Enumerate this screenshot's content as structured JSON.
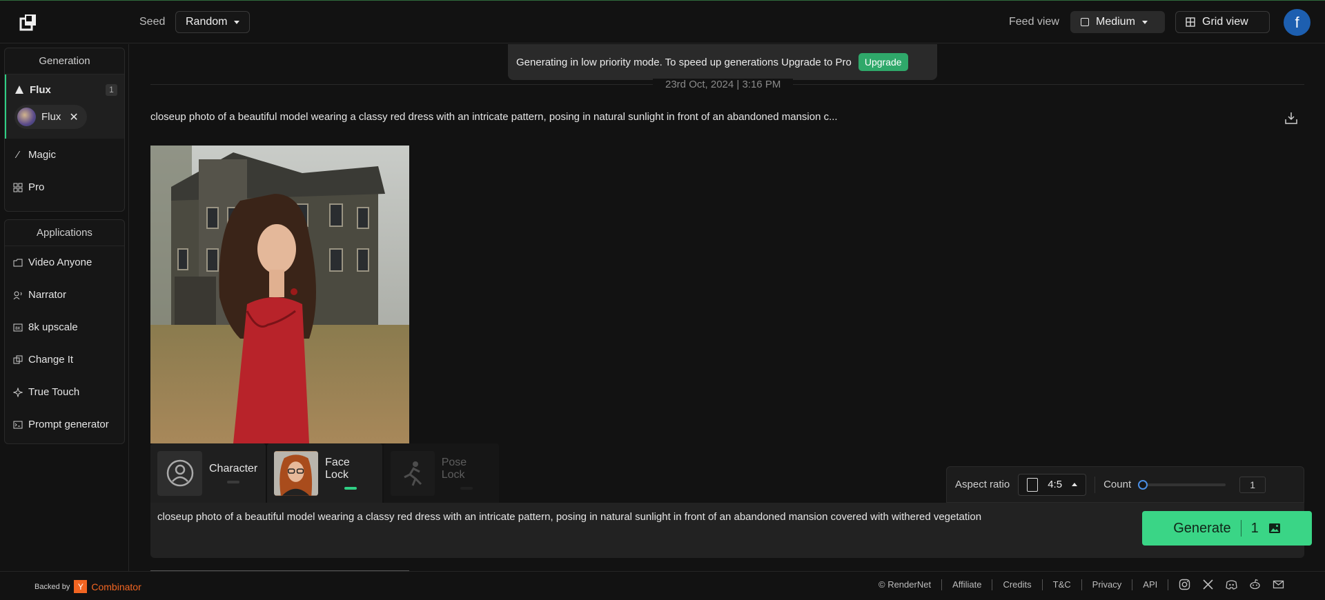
{
  "header": {
    "seed_label": "Seed",
    "seed_value": "Random",
    "feed_view_label": "Feed view",
    "feed_view_value": "Medium",
    "grid_view_label": "Grid view",
    "avatar_letter": "f"
  },
  "sidebar": {
    "generation_title": "Generation",
    "flux_label": "Flux",
    "flux_count": "1",
    "flux_chip_label": "Flux",
    "magic_label": "Magic",
    "pro_label": "Pro",
    "applications_title": "Applications",
    "apps": [
      {
        "label": "Video Anyone",
        "icon": "folder-icon"
      },
      {
        "label": "Narrator",
        "icon": "narrator-icon"
      },
      {
        "label": "8k upscale",
        "icon": "upscale-icon"
      },
      {
        "label": "Change It",
        "icon": "change-icon"
      },
      {
        "label": "True Touch",
        "icon": "sparkle-icon"
      },
      {
        "label": "Prompt generator",
        "icon": "terminal-icon"
      }
    ]
  },
  "banner": {
    "text": "Generating in low priority mode. To speed up generations Upgrade to Pro",
    "button": "Upgrade"
  },
  "feed": {
    "date": "23rd Oct, 2024 | 3:16 PM",
    "prompt": "closeup photo of a beautiful model wearing a classy red dress with an intricate pattern, posing in natural sunlight in front of an abandoned mansion c..."
  },
  "locks": {
    "character": "Character",
    "face_lock": "Face Lock",
    "pose_lock": "Pose Lock"
  },
  "settings": {
    "aspect_label": "Aspect ratio",
    "aspect_value": "4:5",
    "count_label": "Count",
    "count_value": "1"
  },
  "composer": {
    "prompt": "closeup photo of a beautiful model wearing a classy red dress with an intricate pattern, posing in natural sunlight in front of an abandoned mansion covered with withered vegetation",
    "generate_label": "Generate",
    "generate_count": "1"
  },
  "footer": {
    "backed_by": "Backed by",
    "yc_letter": "Y",
    "yc_name": "Combinator",
    "links": [
      "© RenderNet",
      "Affiliate",
      "Credits",
      "T&C",
      "Privacy",
      "API"
    ]
  },
  "colors": {
    "accent_green": "#3ad586",
    "avatar_blue": "#1d5fb0",
    "yc_orange": "#f26522"
  }
}
